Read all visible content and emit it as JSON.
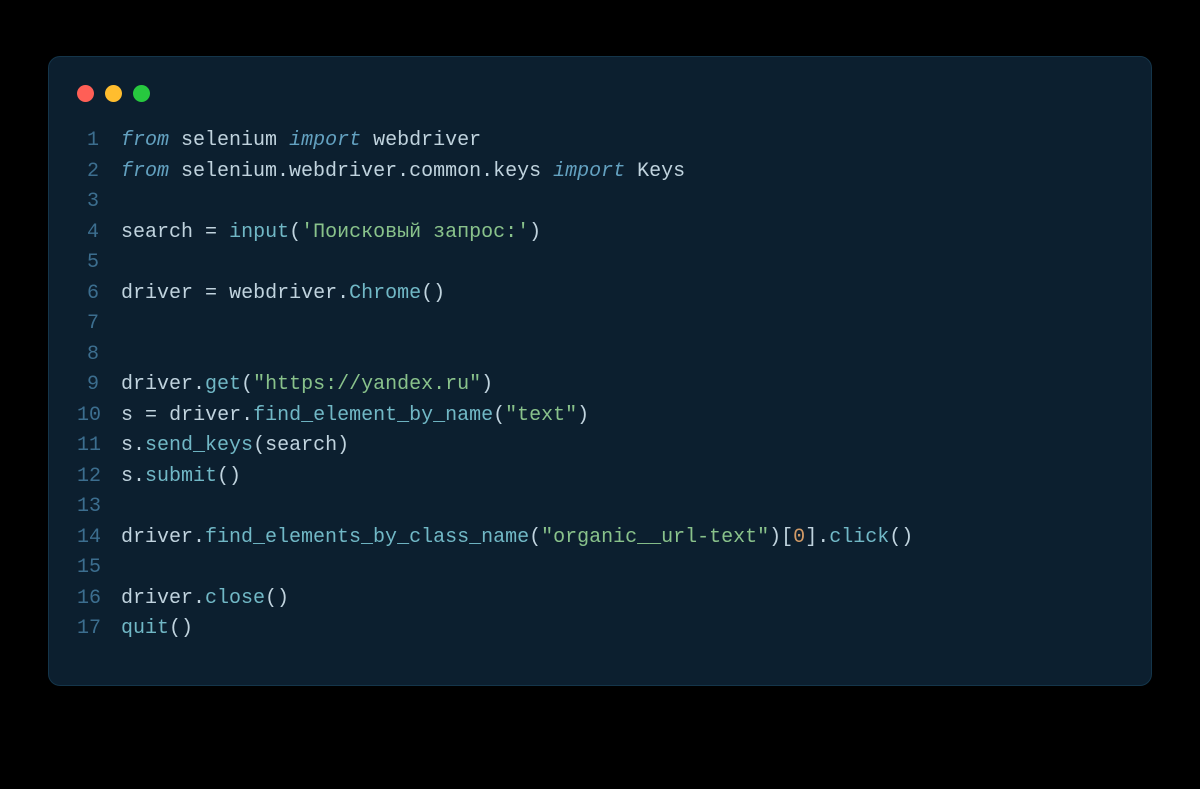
{
  "window": {
    "dots": [
      "close",
      "minimize",
      "maximize"
    ]
  },
  "lines": [
    {
      "n": "1",
      "tokens": [
        {
          "c": "tok-kw-it",
          "t": "from"
        },
        {
          "c": "sp",
          "t": " "
        },
        {
          "c": "tok-mod",
          "t": "selenium"
        },
        {
          "c": "sp",
          "t": " "
        },
        {
          "c": "tok-kw-it",
          "t": "import"
        },
        {
          "c": "sp",
          "t": " "
        },
        {
          "c": "tok-mod",
          "t": "webdriver"
        }
      ]
    },
    {
      "n": "2",
      "tokens": [
        {
          "c": "tok-kw-it",
          "t": "from"
        },
        {
          "c": "sp",
          "t": " "
        },
        {
          "c": "tok-mod",
          "t": "selenium.webdriver.common.keys"
        },
        {
          "c": "sp",
          "t": " "
        },
        {
          "c": "tok-kw-it",
          "t": "import"
        },
        {
          "c": "sp",
          "t": " "
        },
        {
          "c": "tok-mod",
          "t": "Keys"
        }
      ]
    },
    {
      "n": "3",
      "tokens": []
    },
    {
      "n": "4",
      "tokens": [
        {
          "c": "tok-id",
          "t": "search"
        },
        {
          "c": "sp",
          "t": " "
        },
        {
          "c": "tok-op",
          "t": "="
        },
        {
          "c": "sp",
          "t": " "
        },
        {
          "c": "tok-func",
          "t": "input"
        },
        {
          "c": "tok-punc",
          "t": "("
        },
        {
          "c": "tok-str",
          "t": "'Поисковый запрос:'"
        },
        {
          "c": "tok-punc",
          "t": ")"
        }
      ]
    },
    {
      "n": "5",
      "tokens": []
    },
    {
      "n": "6",
      "tokens": [
        {
          "c": "tok-id",
          "t": "driver"
        },
        {
          "c": "sp",
          "t": " "
        },
        {
          "c": "tok-op",
          "t": "="
        },
        {
          "c": "sp",
          "t": " "
        },
        {
          "c": "tok-id",
          "t": "webdriver"
        },
        {
          "c": "tok-punc",
          "t": "."
        },
        {
          "c": "tok-func",
          "t": "Chrome"
        },
        {
          "c": "tok-punc",
          "t": "()"
        }
      ]
    },
    {
      "n": "7",
      "tokens": []
    },
    {
      "n": "8",
      "tokens": []
    },
    {
      "n": "9",
      "tokens": [
        {
          "c": "tok-id",
          "t": "driver"
        },
        {
          "c": "tok-punc",
          "t": "."
        },
        {
          "c": "tok-func",
          "t": "get"
        },
        {
          "c": "tok-punc",
          "t": "("
        },
        {
          "c": "tok-str",
          "t": "\"https://yandex.ru\""
        },
        {
          "c": "tok-punc",
          "t": ")"
        }
      ]
    },
    {
      "n": "10",
      "tokens": [
        {
          "c": "tok-id",
          "t": "s"
        },
        {
          "c": "sp",
          "t": " "
        },
        {
          "c": "tok-op",
          "t": "="
        },
        {
          "c": "sp",
          "t": " "
        },
        {
          "c": "tok-id",
          "t": "driver"
        },
        {
          "c": "tok-punc",
          "t": "."
        },
        {
          "c": "tok-func",
          "t": "find_element_by_name"
        },
        {
          "c": "tok-punc",
          "t": "("
        },
        {
          "c": "tok-str",
          "t": "\"text\""
        },
        {
          "c": "tok-punc",
          "t": ")"
        }
      ]
    },
    {
      "n": "11",
      "tokens": [
        {
          "c": "tok-id",
          "t": "s"
        },
        {
          "c": "tok-punc",
          "t": "."
        },
        {
          "c": "tok-func",
          "t": "send_keys"
        },
        {
          "c": "tok-punc",
          "t": "("
        },
        {
          "c": "tok-id",
          "t": "search"
        },
        {
          "c": "tok-punc",
          "t": ")"
        }
      ]
    },
    {
      "n": "12",
      "tokens": [
        {
          "c": "tok-id",
          "t": "s"
        },
        {
          "c": "tok-punc",
          "t": "."
        },
        {
          "c": "tok-func",
          "t": "submit"
        },
        {
          "c": "tok-punc",
          "t": "()"
        }
      ]
    },
    {
      "n": "13",
      "tokens": []
    },
    {
      "n": "14",
      "tokens": [
        {
          "c": "tok-id",
          "t": "driver"
        },
        {
          "c": "tok-punc",
          "t": "."
        },
        {
          "c": "tok-func",
          "t": "find_elements_by_class_name"
        },
        {
          "c": "tok-punc",
          "t": "("
        },
        {
          "c": "tok-str",
          "t": "\"organic__url-text\""
        },
        {
          "c": "tok-punc",
          "t": ")["
        },
        {
          "c": "tok-num",
          "t": "0"
        },
        {
          "c": "tok-punc",
          "t": "]."
        },
        {
          "c": "tok-func",
          "t": "click"
        },
        {
          "c": "tok-punc",
          "t": "()"
        }
      ]
    },
    {
      "n": "15",
      "tokens": []
    },
    {
      "n": "16",
      "tokens": [
        {
          "c": "tok-id",
          "t": "driver"
        },
        {
          "c": "tok-punc",
          "t": "."
        },
        {
          "c": "tok-func",
          "t": "close"
        },
        {
          "c": "tok-punc",
          "t": "()"
        }
      ]
    },
    {
      "n": "17",
      "tokens": [
        {
          "c": "tok-func",
          "t": "quit"
        },
        {
          "c": "tok-punc",
          "t": "()"
        }
      ]
    }
  ]
}
